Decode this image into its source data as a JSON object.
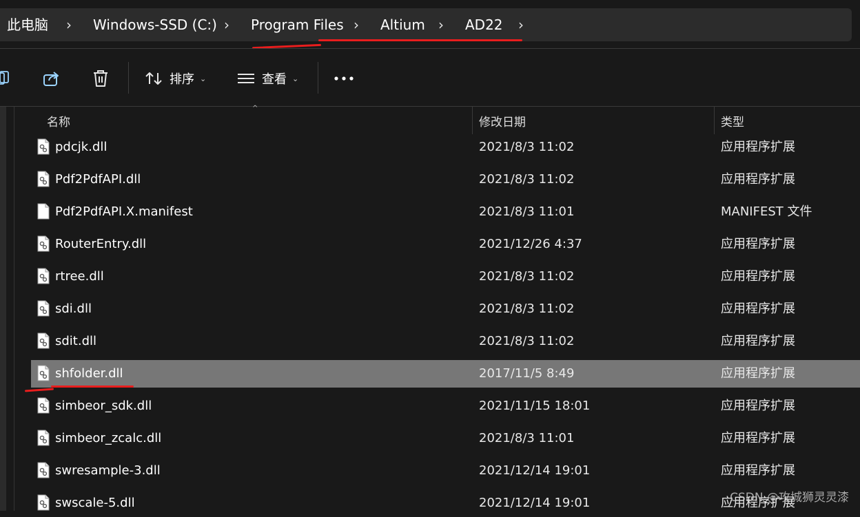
{
  "breadcrumb": {
    "items": [
      "此电脑",
      "Windows-SSD (C:)",
      "Program Files",
      "Altium",
      "AD22"
    ]
  },
  "toolbar": {
    "sort_label": "排序",
    "view_label": "查看"
  },
  "columns": {
    "name": "名称",
    "date": "修改日期",
    "type": "类型"
  },
  "files": [
    {
      "name": "pdcjk.dll",
      "date": "2021/8/3 11:02",
      "type": "应用程序扩展",
      "icon": "dll-file-icon"
    },
    {
      "name": "Pdf2PdfAPI.dll",
      "date": "2021/8/3 11:02",
      "type": "应用程序扩展",
      "icon": "dll-file-icon"
    },
    {
      "name": "Pdf2PdfAPI.X.manifest",
      "date": "2021/8/3 11:01",
      "type": "MANIFEST 文件",
      "icon": "blank-file-icon"
    },
    {
      "name": "RouterEntry.dll",
      "date": "2021/12/26 4:37",
      "type": "应用程序扩展",
      "icon": "dll-file-icon"
    },
    {
      "name": "rtree.dll",
      "date": "2021/8/3 11:02",
      "type": "应用程序扩展",
      "icon": "dll-file-icon"
    },
    {
      "name": "sdi.dll",
      "date": "2021/8/3 11:02",
      "type": "应用程序扩展",
      "icon": "dll-file-icon"
    },
    {
      "name": "sdit.dll",
      "date": "2021/8/3 11:02",
      "type": "应用程序扩展",
      "icon": "dll-file-icon"
    },
    {
      "name": "shfolder.dll",
      "date": "2017/11/5 8:49",
      "type": "应用程序扩展",
      "icon": "dll-file-icon",
      "selected": true
    },
    {
      "name": "simbeor_sdk.dll",
      "date": "2021/11/15 18:01",
      "type": "应用程序扩展",
      "icon": "dll-file-icon"
    },
    {
      "name": "simbeor_zcalc.dll",
      "date": "2021/8/3 11:01",
      "type": "应用程序扩展",
      "icon": "dll-file-icon"
    },
    {
      "name": "swresample-3.dll",
      "date": "2021/12/14 19:01",
      "type": "应用程序扩展",
      "icon": "dll-file-icon"
    },
    {
      "name": "swscale-5.dll",
      "date": "2021/12/14 19:01",
      "type": "应用程序扩展",
      "icon": "dll-file-icon"
    }
  ],
  "watermark": "CSDN @攻城狮灵灵漆",
  "colors": {
    "background": "#191919",
    "selection": "#777777",
    "annotation_red": "#e81d1d"
  }
}
